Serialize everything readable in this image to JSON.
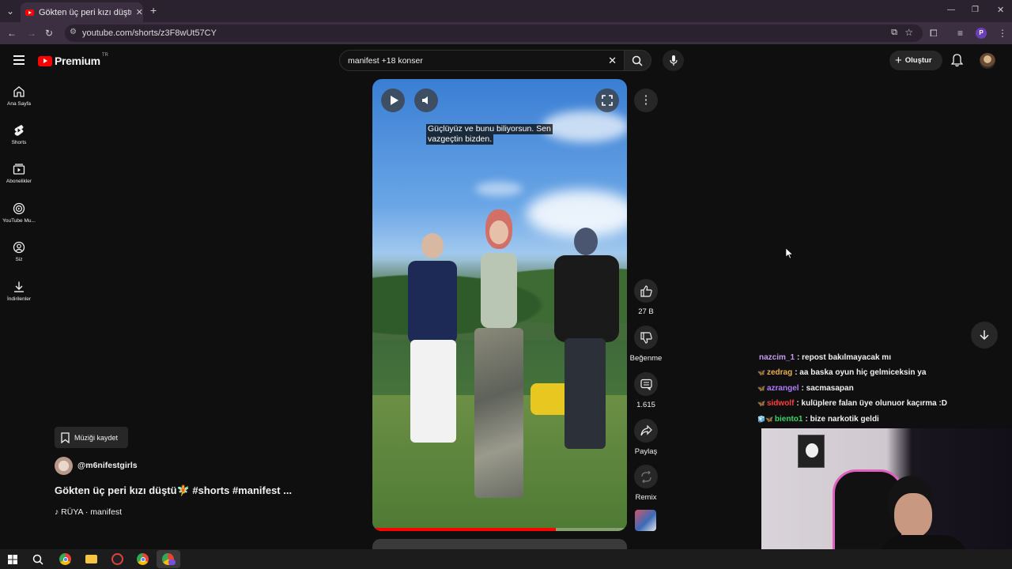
{
  "browser": {
    "tab_title": "Gökten üç peri kızı düştü🧚 #sh",
    "new_tab": "+",
    "url": "youtube.com/shorts/z3F8wUt57CY",
    "profile_initial": "P"
  },
  "header": {
    "logo_text": "Premium",
    "region": "TR",
    "search_value": "manifest +18 konser",
    "create_label": "Oluştur"
  },
  "sidebar": {
    "items": [
      {
        "label": "Ana Sayfa"
      },
      {
        "label": "Shorts"
      },
      {
        "label": "Abonelikler"
      },
      {
        "label": "YouTube Mu..."
      },
      {
        "label": "Siz"
      },
      {
        "label": "İndirilenler"
      }
    ]
  },
  "video": {
    "caption_line1": "Güçlüyüz ve bunu biliyorsun. Sen",
    "caption_line2": "vazgeçtin bizden.",
    "progress": 0.72
  },
  "actions": {
    "like_count": "27 B",
    "dislike_label": "Beğenme",
    "comment_count": "1.615",
    "share_label": "Paylaş",
    "remix_label": "Remix"
  },
  "meta": {
    "save_music": "Müziği kaydet",
    "channel": "@m6nifestgirls",
    "title": "Gökten üç peri kızı düştü🧚 #shorts #manifest ...",
    "music": "♪ RÜYA · manifest"
  },
  "chat": [
    {
      "user": "nazcim_1",
      "message": ": repost bakılmayacak mı",
      "color": "#c79bf2",
      "badge": ""
    },
    {
      "user": "zedrag",
      "message": ": aa baska oyun hiç gelmiceksin ya",
      "color": "#e8b04a",
      "badge": "🦋"
    },
    {
      "user": "azrangel",
      "message": ": sacmasapan",
      "color": "#b07cff",
      "badge": "🦋"
    },
    {
      "user": "sidwolf",
      "message": ": kulüplere falan üye olunuor kaçırma :D",
      "color": "#ff4040",
      "badge": "🦋"
    },
    {
      "user": "biento1",
      "message": ": bize narkotik geldi",
      "color": "#3ad46a",
      "badge": "🧊🦋"
    }
  ],
  "colors": {
    "yt_red": "#ff0000",
    "chrome_bg": "#3c2f42",
    "page_bg": "#0f0f0f"
  }
}
